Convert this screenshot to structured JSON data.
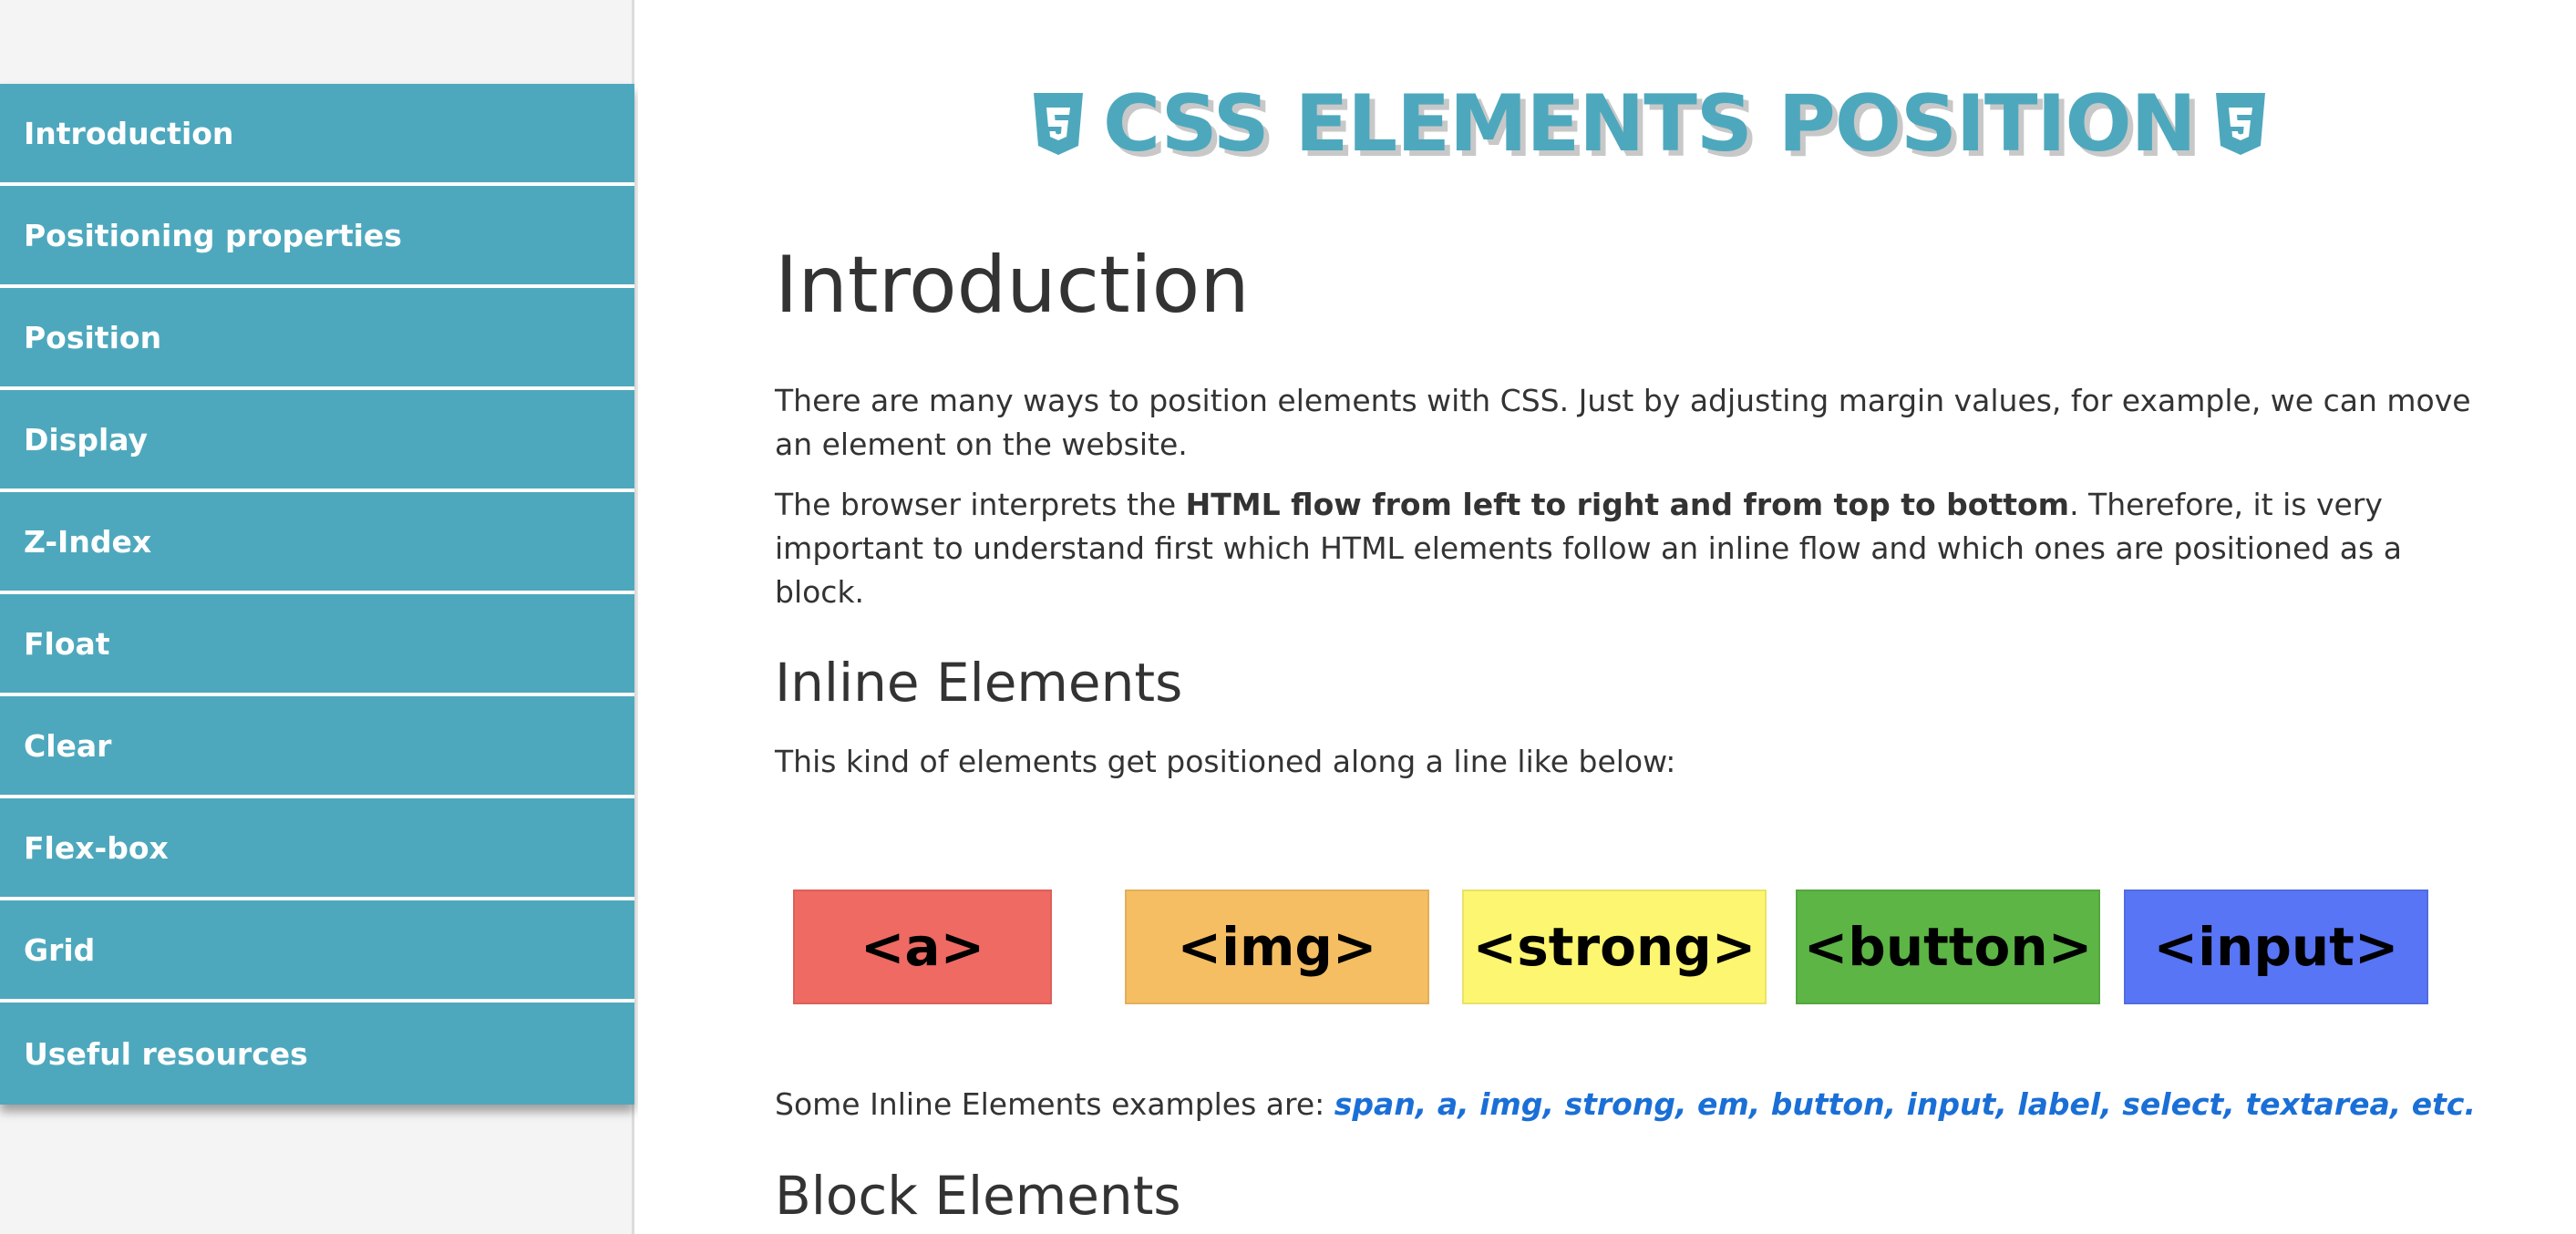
{
  "sidebar": {
    "items": [
      {
        "label": "Introduction"
      },
      {
        "label": "Positioning properties"
      },
      {
        "label": "Position"
      },
      {
        "label": "Display"
      },
      {
        "label": "Z-Index"
      },
      {
        "label": "Float"
      },
      {
        "label": "Clear"
      },
      {
        "label": "Flex-box"
      },
      {
        "label": "Grid"
      },
      {
        "label": "Useful resources"
      }
    ]
  },
  "header": {
    "title": "CSS ELEMENTS POSITION",
    "badge_icon": "css3-shield-icon",
    "accent_color": "#4ea8bd"
  },
  "main": {
    "section_title": "Introduction",
    "p1": "There are many ways to position elements with CSS. Just by adjusting margin values, for example, we can move an element on the website.",
    "p2_start": "The browser interprets the ",
    "p2_bold": "HTML flow from left to right and from top to bottom",
    "p2_end": ". Therefore, it is very important to understand first which HTML elements follow an inline flow and which ones are positioned as a block.",
    "inline_title": "Inline Elements",
    "inline_desc": "This kind of elements get positioned along a line like below:",
    "inline_boxes": [
      {
        "label": "<a>",
        "color": "#ee6a62"
      },
      {
        "label": "<img>",
        "color": "#f5be62"
      },
      {
        "label": "<strong>",
        "color": "#fdf670"
      },
      {
        "label": "<button>",
        "color": "#5cb545"
      },
      {
        "label": "<input>",
        "color": "#5875f5"
      }
    ],
    "examples_prefix": "Some Inline Elements examples are: ",
    "examples_list": "span, a, img, strong, em, button, input, label, select, textarea, etc.",
    "block_title": "Block Elements"
  }
}
